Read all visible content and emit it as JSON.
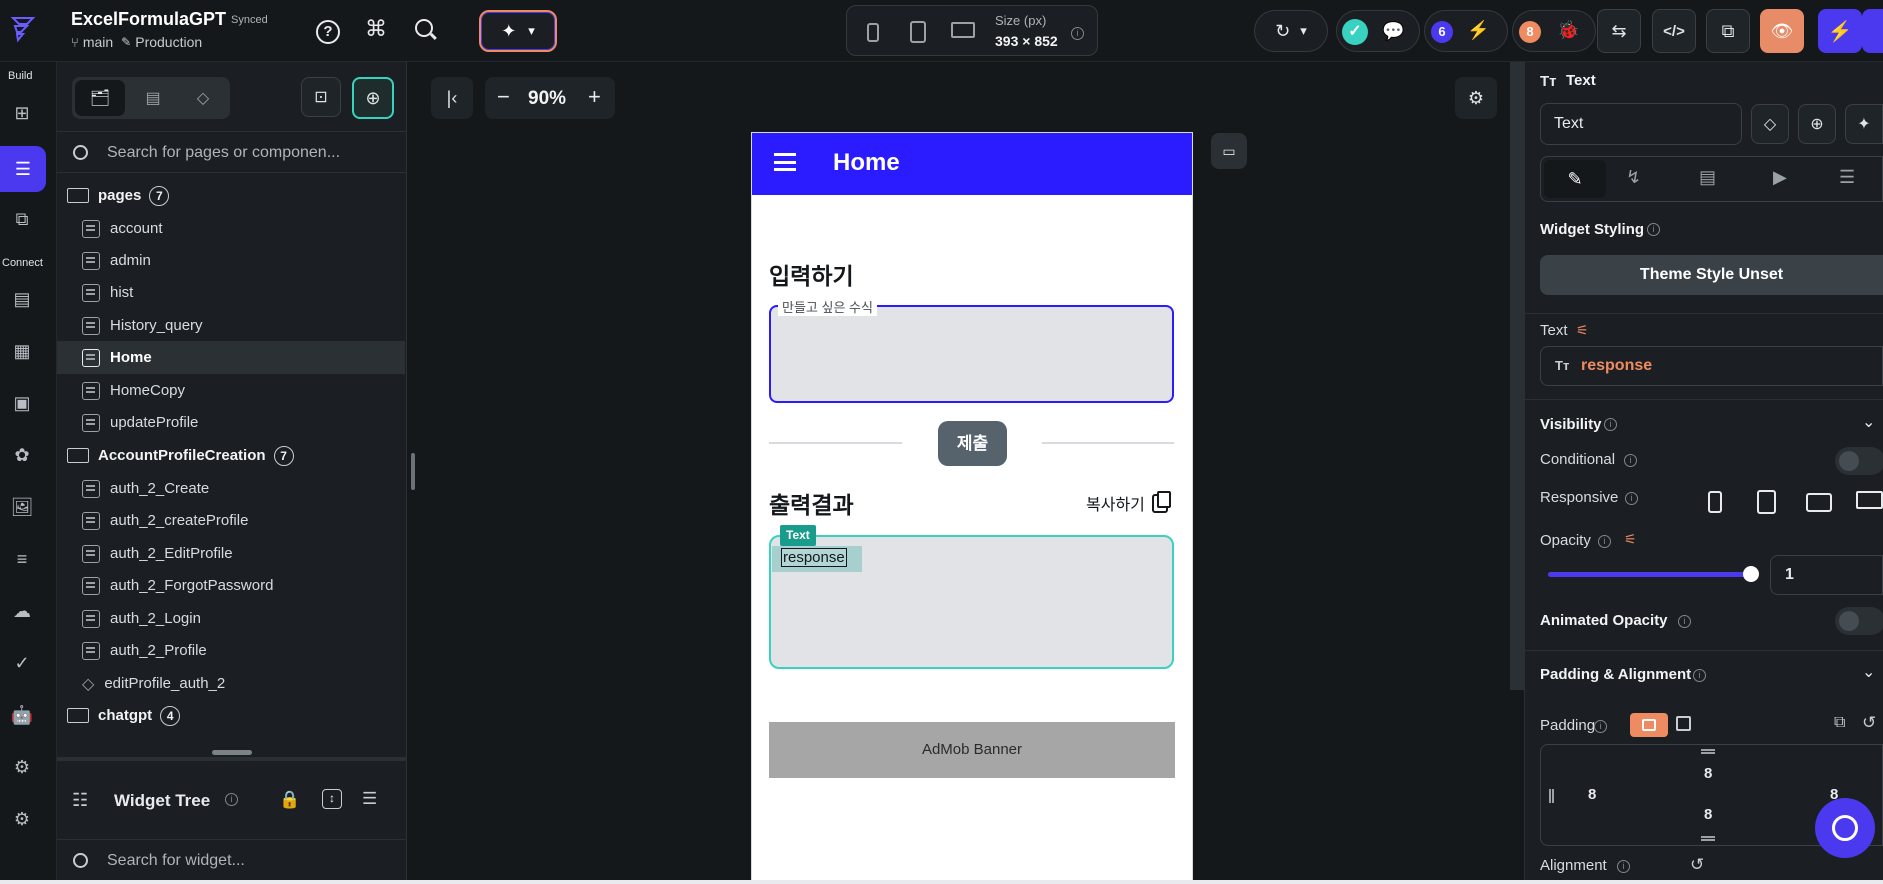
{
  "app": {
    "title": "ExcelFormulaGPT",
    "sync_status": "Synced",
    "branch": "main",
    "environment": "Production"
  },
  "toolbar": {
    "size_label": "Size (px)",
    "size_value": "393 × 852",
    "badge_a": "6",
    "badge_b": "8"
  },
  "rail": {
    "build_label": "Build",
    "connect_label": "Connect"
  },
  "left_panel": {
    "search_placeholder": "Search for pages or componen...",
    "folders": [
      {
        "name": "pages",
        "count": "7"
      },
      {
        "name": "AccountProfileCreation",
        "count": "7"
      },
      {
        "name": "chatgpt",
        "count": "4"
      }
    ],
    "pages": [
      "account",
      "admin",
      "hist",
      "History_query",
      "Home",
      "HomeCopy",
      "updateProfile"
    ],
    "account_pages": [
      "auth_2_Create",
      "auth_2_createProfile",
      "auth_2_EditProfile",
      "auth_2_ForgotPassword",
      "auth_2_Login",
      "auth_2_Profile",
      "editProfile_auth_2"
    ],
    "widget_tree_label": "Widget Tree",
    "widget_search_placeholder": "Search for widget..."
  },
  "canvas": {
    "zoom": "90%",
    "app_bar_title": "Home",
    "input_heading": "입력하기",
    "input_label": "만들고 싶은 수식",
    "submit_label": "제출",
    "output_heading": "출력결과",
    "copy_label": "복사하기",
    "selected_tag": "Text",
    "response_text": "response",
    "admob_label": "AdMob Banner"
  },
  "right_panel": {
    "header": "Text",
    "name_value": "Text",
    "widget_styling": "Widget Styling",
    "theme_style": "Theme Style Unset",
    "text_label": "Text",
    "text_value": "response",
    "visibility": "Visibility",
    "conditional": "Conditional",
    "responsive": "Responsive",
    "opacity": "Opacity",
    "opacity_value": "1",
    "opacity_level": 1,
    "animated_opacity": "Animated Opacity",
    "padding_alignment": "Padding & Alignment",
    "padding": "Padding",
    "pad_top": "8",
    "pad_left": "8",
    "pad_right": "8",
    "pad_bottom": "8",
    "alignment": "Alignment"
  },
  "colors": {
    "brand": "#2b1cff",
    "accent_teal": "#39d2c0",
    "orange": "#ee8b60",
    "primary_purple": "#4b39ef"
  }
}
